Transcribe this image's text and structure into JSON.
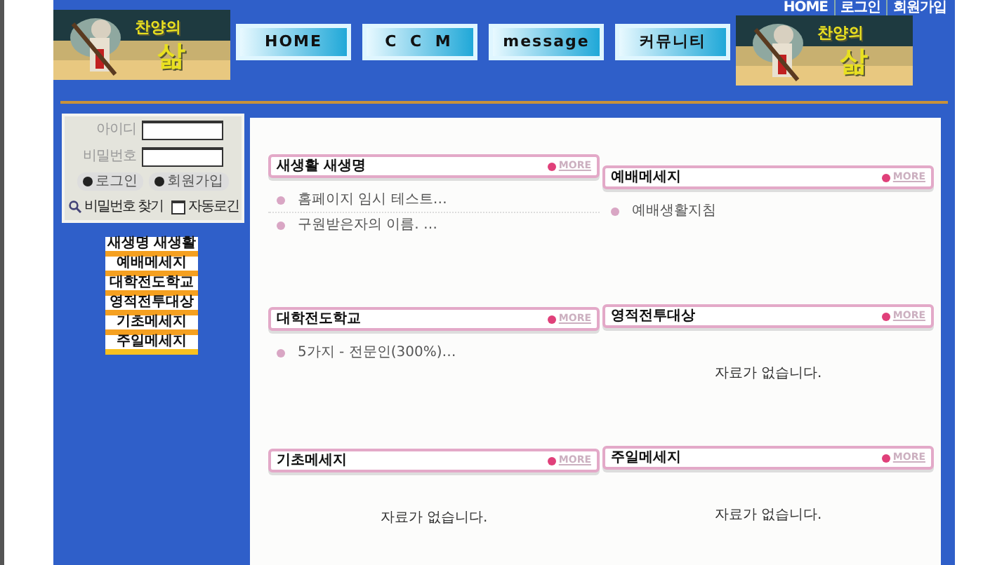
{
  "header": {
    "top_links": [
      "HOME",
      "로그인",
      "회원가입"
    ],
    "logos": [
      {
        "line1": "찬양의",
        "line2": "삶"
      },
      {
        "line1": "찬양의",
        "line2": "삶"
      }
    ],
    "nav": [
      {
        "label": "HOME"
      },
      {
        "label": "C C M"
      },
      {
        "label": "message"
      },
      {
        "label": "커뮤니티"
      }
    ]
  },
  "login": {
    "id_label": "아이디",
    "pw_label": "비밀번호",
    "buttons": [
      "로그인",
      "회원가입"
    ],
    "find_password": "비밀번호 찾기",
    "auto_login": {
      "label": "자동로긴",
      "checked": false
    }
  },
  "menu": [
    "새생명 새생활",
    "예배메세지",
    "대학전도학교",
    "영적전투대상",
    "기초메세지",
    "주일메세지"
  ],
  "panels": [
    {
      "title": "새생활 새생명",
      "more": "MORE",
      "items": [
        "홈페이지 임시 테스트…",
        "구원받은자의 이름. …"
      ]
    },
    {
      "title": "예배메세지",
      "more": "MORE",
      "items": [
        "예배생활지침"
      ]
    },
    {
      "title": "대학전도학교",
      "more": "MORE",
      "items": [
        "5가지 - 전문인(300%)…"
      ]
    },
    {
      "title": "영적전투대상",
      "more": "MORE",
      "empty": "자료가 없습니다."
    },
    {
      "title": "기초메세지",
      "more": "MORE",
      "empty": "자료가 없습니다."
    },
    {
      "title": "주일메세지",
      "more": "MORE",
      "empty": "자료가 없습니다."
    }
  ]
}
